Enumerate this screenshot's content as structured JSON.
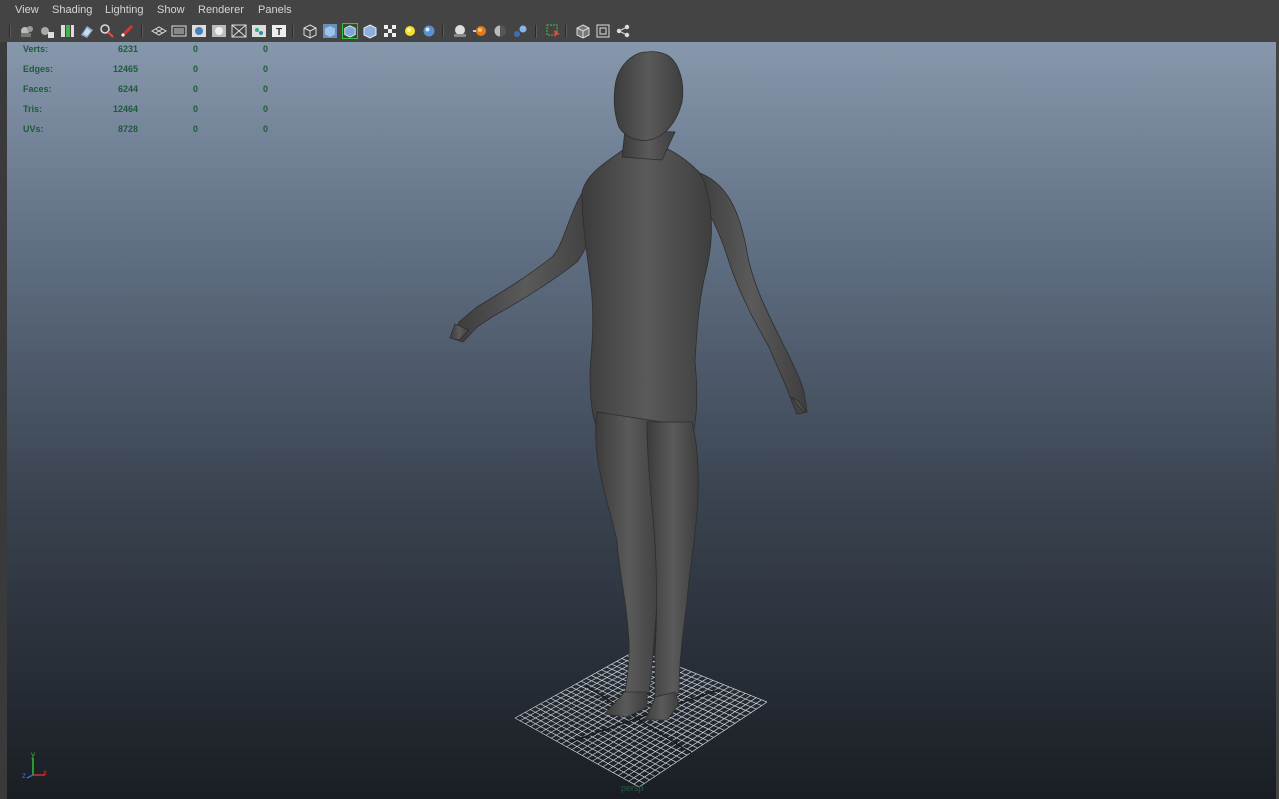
{
  "menu": [
    "View",
    "Shading",
    "Lighting",
    "Show",
    "Renderer",
    "Panels"
  ],
  "toolbar_icons": [
    "select-camera-icon",
    "camera-attributes-icon",
    "bookmarks-icon",
    "image-plane-icon",
    "2d-pan-zoom-icon",
    "grease-pencil-icon",
    "grid-icon",
    "film-gate-icon",
    "resolution-gate-icon",
    "gate-mask-icon",
    "field-chart-icon",
    "safe-action-icon",
    "safe-title-icon",
    "wireframe-icon",
    "smooth-shade-icon",
    "wireframe-on-shaded-icon",
    "default-material-icon",
    "textured-icon",
    "use-lights-icon",
    "shadows-icon",
    "ambient-occlusion-icon",
    "motion-blur-icon",
    "multisample-aa-icon",
    "depth-of-field-icon",
    "isolate-select-icon",
    "xray-icon",
    "xray-joints-icon",
    "xray-active-components-icon"
  ],
  "hud": {
    "rows": [
      {
        "label": "Verts:",
        "values": [
          "6231",
          "0",
          "0"
        ]
      },
      {
        "label": "Edges:",
        "values": [
          "12465",
          "0",
          "0"
        ]
      },
      {
        "label": "Faces:",
        "values": [
          "6244",
          "0",
          "0"
        ]
      },
      {
        "label": "Tris:",
        "values": [
          "12464",
          "0",
          "0"
        ]
      },
      {
        "label": "UVs:",
        "values": [
          "8728",
          "0",
          "0"
        ]
      }
    ]
  },
  "camera_label": "persp",
  "axis": {
    "y": "y",
    "x": "x",
    "z": "z"
  },
  "colors": {
    "hud_text": "#1f5a3a",
    "menu_bg": "#444444",
    "sky_top": "#8797ac",
    "sky_bottom": "#1a1e24"
  }
}
